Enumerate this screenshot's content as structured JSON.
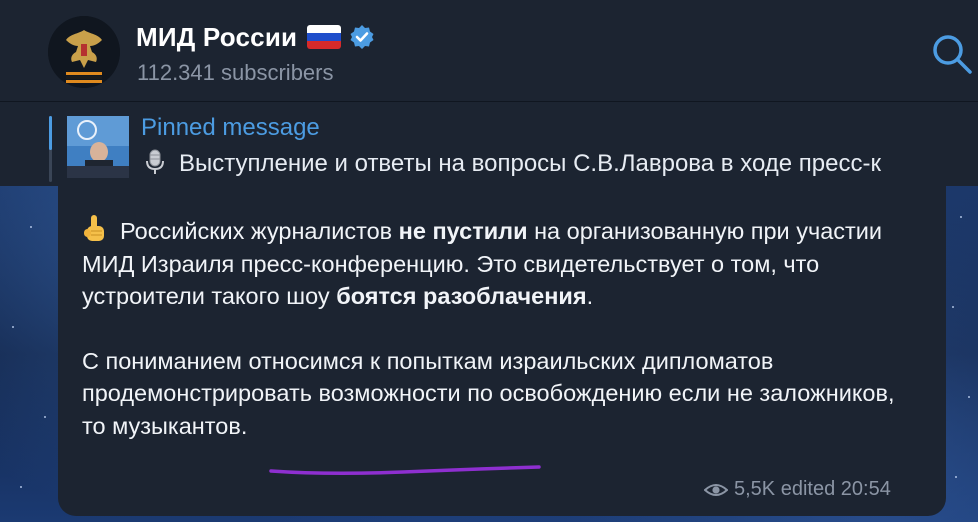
{
  "channel": {
    "title": "МИД России",
    "subscribers": "112.341 subscribers",
    "flag_colors": [
      "#ffffff",
      "#1f4ecb",
      "#d62a2a"
    ],
    "verified_color": "#4c9ce2"
  },
  "pinned": {
    "label": "Pinned message",
    "text": "Выступление и ответы на вопросы С.В.Лаврова в ходе пресс-к"
  },
  "message": {
    "p1_a": "Российских журналистов ",
    "p1_b": "не пустили",
    "p1_c": " на организованную при участии МИД Израиля пресс-конференцию. Это свидетельствует о том, что устроители такого шоу ",
    "p1_d": "боятся разобла­чения",
    "p1_e": ".",
    "p2": "С пониманием относимся к попыткам израильских дипломатов продемонстрировать возможности по освобождению если не заложников, то музыкантов.",
    "views": "5,5K",
    "edited": "edited 20:54"
  },
  "icons": {
    "search": "search-icon",
    "eye": "eye-icon",
    "hand": "index-pointing-up-emoji",
    "mic": "microphone-emoji",
    "verified": "verified-badge-icon"
  },
  "colors": {
    "accent": "#4c9ce2",
    "panel": "#1c2431",
    "annotation": "#8e2fd0"
  }
}
